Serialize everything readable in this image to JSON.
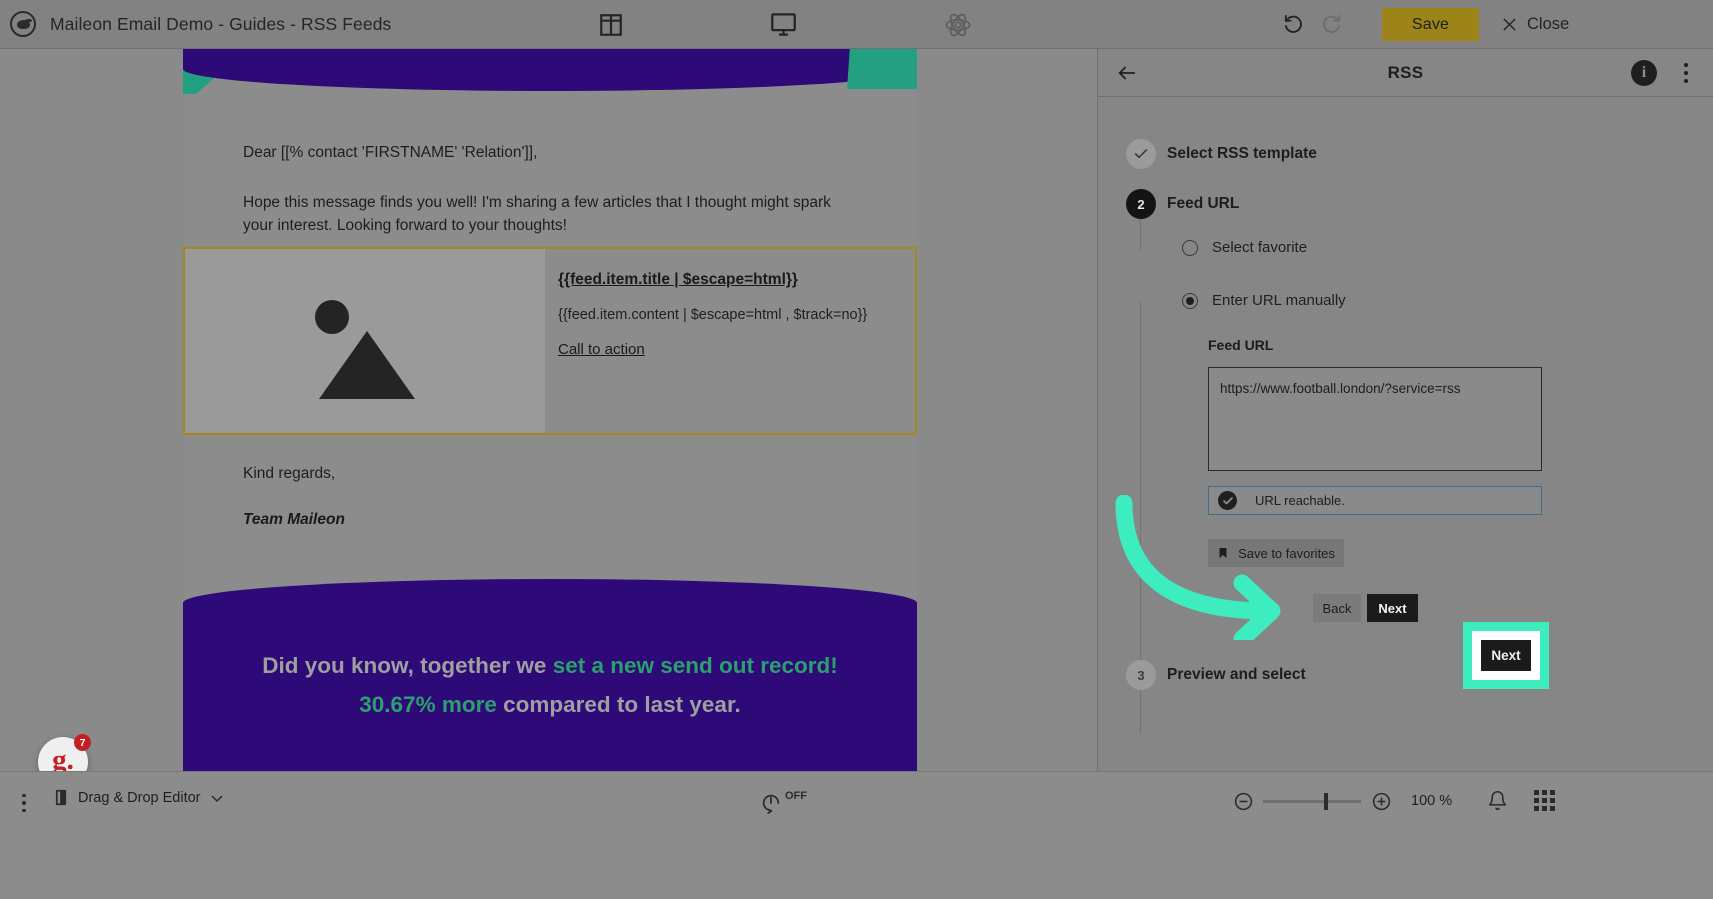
{
  "topbar": {
    "brand_title": "Maileon Email Demo - Guides - RSS Feeds",
    "icons": {
      "layout": "layout-columns-icon",
      "desktop": "desktop-preview-icon",
      "atom": "atom-icon",
      "undo": "undo-icon",
      "redo": "redo-icon"
    },
    "save_label": "Save",
    "close_label": "Close"
  },
  "mail": {
    "greeting": "Dear [[% contact 'FIRSTNAME' 'Relation']],",
    "intro": "Hope this message finds you well! I'm sharing a few articles that I thought might spark your interest. Looking forward to your thoughts!",
    "rss_block": {
      "title": "{{feed.item.title | $escape=html}}",
      "content": "{{feed.item.content | $escape=html , $track=no}}",
      "cta": "Call to action"
    },
    "regards": "Kind regards,",
    "team": "Team Maileon",
    "banner": {
      "part1": "Did you know, together we ",
      "highlight1": "set a new send out record! 30.67% more",
      "part2": " compared to last year."
    }
  },
  "panel": {
    "title": "RSS",
    "back_icon": "arrow-left-icon",
    "info_icon": "info-icon",
    "info_glyph": "i",
    "more_icon": "more-vertical-icon",
    "steps": [
      {
        "number": "1",
        "state": "done",
        "label": "Select RSS template"
      },
      {
        "number": "2",
        "state": "active",
        "label": "Feed URL"
      },
      {
        "number": "3",
        "state": "idle",
        "label": "Preview and select"
      }
    ],
    "step2": {
      "radio_favorite_label": "Select favorite",
      "radio_manual_label": "Enter URL manually",
      "feed_url_label": "Feed URL",
      "feed_url_value": "https://www.football.london/?service=rss",
      "status_text": "URL reachable.",
      "status_icon": "check-circle-icon",
      "status_border_color": "#3d6f86",
      "save_favorites_label": "Save to favorites",
      "save_favorites_icon": "bookmark-icon",
      "back_label": "Back",
      "next_label": "Next"
    }
  },
  "annotation": {
    "arrow_color": "#3dedc0",
    "highlight_color": "#3dedc0",
    "highlighted_button_label": "Next"
  },
  "bottombar": {
    "more_icon": "more-vertical-icon",
    "editor_icon": "editor-block-icon",
    "editor_label": "Drag & Drop Editor",
    "chevron_icon": "chevron-down-icon",
    "track_icon": "tracking-icon",
    "track_state": "OFF",
    "zoom_out_icon": "zoom-out-icon",
    "zoom_in_icon": "zoom-in-icon",
    "zoom_value": "100 %",
    "bell_icon": "bell-icon",
    "apps_icon": "apps-grid-icon"
  },
  "chat": {
    "logo_letter": "g.",
    "badge_count": "7"
  }
}
